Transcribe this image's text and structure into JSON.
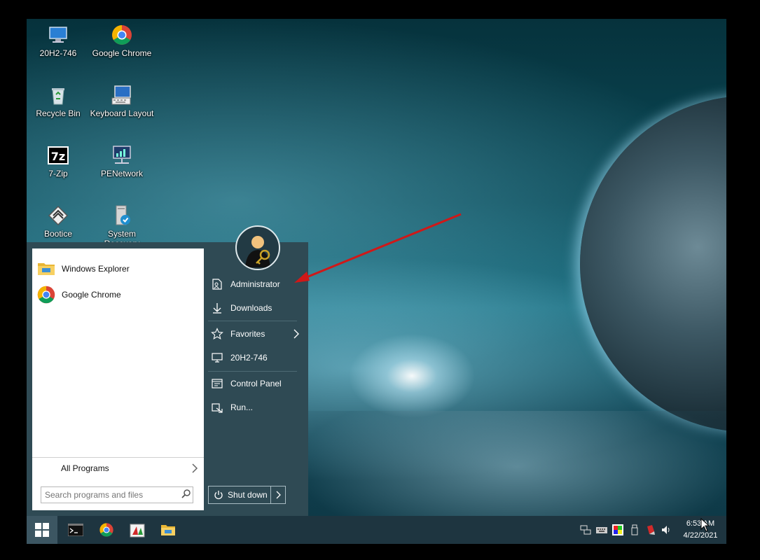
{
  "desktop": {
    "icons": [
      {
        "label": "20H2-746",
        "icon": "computer-icon"
      },
      {
        "label": "Google Chrome",
        "icon": "chrome-icon"
      },
      {
        "label": "Recycle Bin",
        "icon": "recycle-bin-icon"
      },
      {
        "label": "Keyboard Layout",
        "icon": "keyboard-icon"
      },
      {
        "label": "7-Zip",
        "icon": "7zip-icon"
      },
      {
        "label": "PENetwork",
        "icon": "network-icon"
      },
      {
        "label": "Bootice",
        "icon": "bootice-icon"
      },
      {
        "label": "System Recovery",
        "icon": "system-recovery-icon"
      }
    ]
  },
  "start_menu": {
    "pinned": [
      {
        "label": "Windows Explorer",
        "icon": "folder-icon"
      },
      {
        "label": "Google Chrome",
        "icon": "chrome-icon"
      }
    ],
    "all_programs_label": "All Programs",
    "search_placeholder": "Search programs and files",
    "right_items": [
      {
        "label": "Administrator",
        "icon": "user-document-icon"
      },
      {
        "label": "Downloads",
        "icon": "download-icon"
      },
      {
        "label": "Favorites",
        "icon": "star-icon"
      },
      {
        "label": "20H2-746",
        "icon": "computer-icon"
      },
      {
        "label": "Control Panel",
        "icon": "control-panel-icon"
      },
      {
        "label": "Run...",
        "icon": "run-icon"
      }
    ],
    "shutdown_label": "Shut down"
  },
  "taskbar": {
    "buttons": [
      "start-icon",
      "terminal-icon",
      "chrome-icon",
      "paint-icon",
      "file-explorer-icon"
    ],
    "tray": [
      "network-icon",
      "keyboard-icon",
      "color-icon",
      "usb-icon",
      "shield-icon",
      "volume-icon"
    ],
    "time": "6:53 AM",
    "date": "4/22/2021"
  },
  "colors": {
    "start_right": "#2f4a54",
    "taskbar": "#1e3540",
    "arrow": "#d01818"
  }
}
